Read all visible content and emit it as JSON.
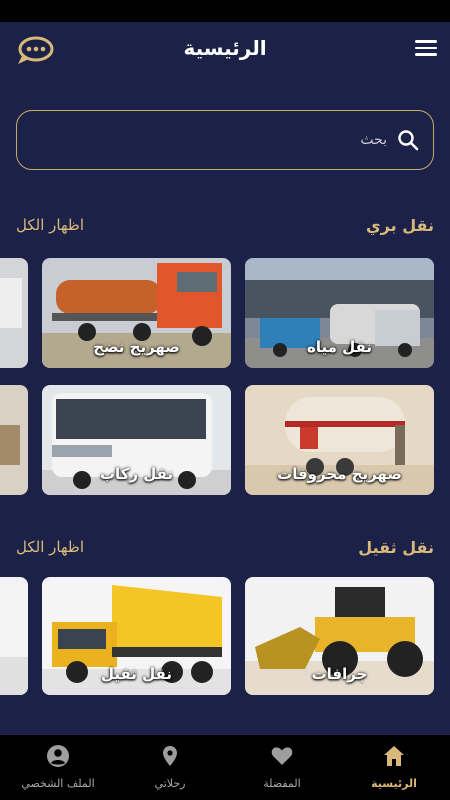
{
  "header": {
    "title": "الرئيسية"
  },
  "search": {
    "placeholder": "بحث"
  },
  "sections": [
    {
      "title": "نقل بري",
      "see_all": "اظهار الكل",
      "items": [
        {
          "label": "نقل مياه"
        },
        {
          "label": "صهريج نضح"
        },
        {
          "label": "صهريج محروقات"
        },
        {
          "label": "نقل ركاب"
        }
      ]
    },
    {
      "title": "نقل ثقيل",
      "see_all": "اظهار الكل",
      "items": [
        {
          "label": "جرافات"
        },
        {
          "label": "نقل ثقيل"
        }
      ]
    }
  ],
  "bottom_nav": [
    {
      "label": "الرئيسية",
      "icon": "home-icon",
      "active": true
    },
    {
      "label": "المفضلة",
      "icon": "heart-icon",
      "active": false
    },
    {
      "label": "رحلاتي",
      "icon": "location-pin-icon",
      "active": false
    },
    {
      "label": "الملف الشخصي",
      "icon": "account-icon",
      "active": false
    }
  ],
  "colors": {
    "background": "#1c2247",
    "accent": "#d9b97a",
    "nav_bg": "#000000"
  }
}
